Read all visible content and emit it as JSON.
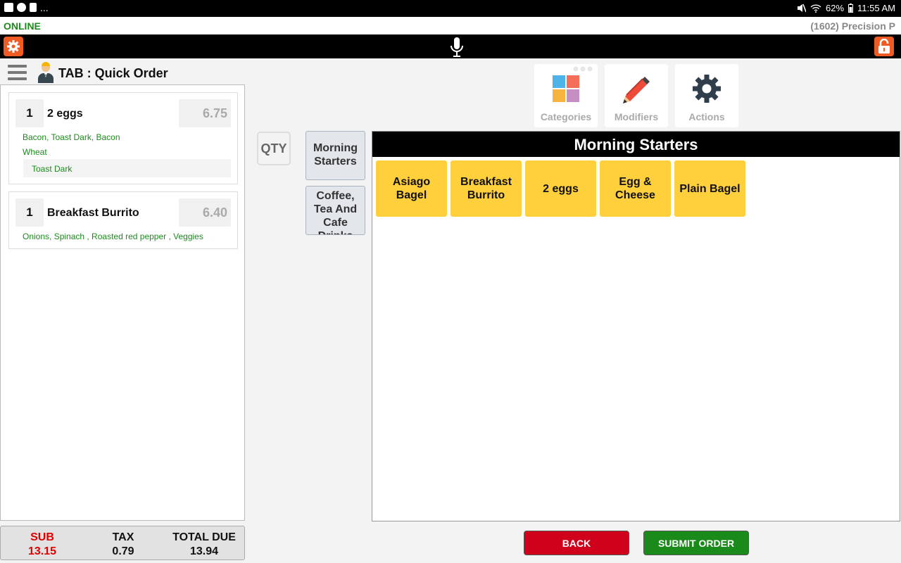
{
  "status_bar": {
    "battery": "62%",
    "time": "11:55 AM",
    "more": "..."
  },
  "connection": {
    "status": "ONLINE",
    "terminal": "(1602) Precision P"
  },
  "header": {
    "title": "TAB : Quick Order"
  },
  "order": {
    "items": [
      {
        "qty": "1",
        "name": "2 eggs",
        "price": "6.75",
        "modifiers": "Bacon, Toast Dark, Bacon",
        "modifiers2": "Wheat",
        "sub_modifier": "Toast Dark"
      },
      {
        "qty": "1",
        "name": "Breakfast Burrito",
        "price": "6.40",
        "modifiers": "Onions, Spinach ,  Roasted red pepper , Veggies"
      }
    ]
  },
  "totals": {
    "sub_label": "SUB",
    "sub_value": "13.15",
    "tax_label": "TAX",
    "tax_value": "0.79",
    "total_label": "TOTAL DUE",
    "total_value": "13.94"
  },
  "qty_label": "QTY",
  "categories": [
    {
      "label": "Morning Starters"
    },
    {
      "label": "Coffee, Tea And Cafe Drinks"
    }
  ],
  "tiles": {
    "categories": "Categories",
    "modifiers": "Modifiers",
    "actions": "Actions"
  },
  "panel": {
    "title": "Morning Starters",
    "items": [
      "Asiago Bagel",
      "Breakfast Burrito",
      "2 eggs",
      "Egg & Cheese",
      "Plain Bagel"
    ]
  },
  "buttons": {
    "back": "BACK",
    "submit": "SUBMIT ORDER"
  },
  "colors": {
    "online": "#1e8a1e",
    "accent_orange": "#f05a23",
    "item_yellow": "#ffcf3c",
    "back_red": "#d0021b",
    "submit_green": "#1a8a1a",
    "sub_red": "#e00000"
  }
}
